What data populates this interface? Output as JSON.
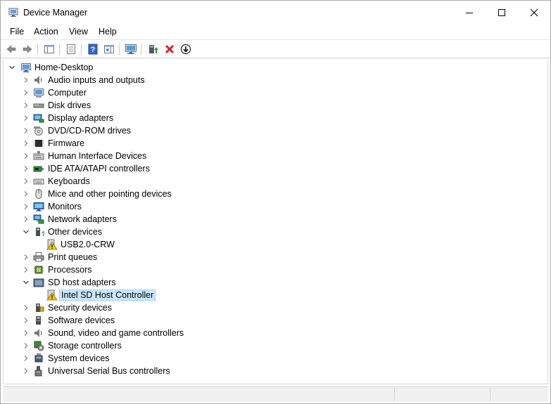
{
  "window": {
    "title": "Device Manager",
    "controls": {
      "minimize": "minimize",
      "maximize": "maximize",
      "close": "close"
    }
  },
  "menubar": {
    "items": [
      "File",
      "Action",
      "View",
      "Help"
    ]
  },
  "toolbar": {
    "buttons": [
      "back-arrow-icon",
      "forward-arrow-icon",
      "show-hide-console-tree-icon",
      "properties-icon",
      "help-icon",
      "action-pane-icon",
      "scan-hardware-icon",
      "update-driver-icon",
      "uninstall-device-icon",
      "disable-device-icon"
    ]
  },
  "tree": {
    "root": "Home-Desktop",
    "items": [
      {
        "label": "Audio inputs and outputs",
        "icon": "speaker-icon",
        "expanded": false
      },
      {
        "label": "Computer",
        "icon": "computer-icon",
        "expanded": false
      },
      {
        "label": "Disk drives",
        "icon": "disk-drive-icon",
        "expanded": false
      },
      {
        "label": "Display adapters",
        "icon": "display-adapter-icon",
        "expanded": false
      },
      {
        "label": "DVD/CD-ROM drives",
        "icon": "dvd-drive-icon",
        "expanded": false
      },
      {
        "label": "Firmware",
        "icon": "firmware-chip-icon",
        "expanded": false
      },
      {
        "label": "Human Interface Devices",
        "icon": "hid-keyboard-icon",
        "expanded": false
      },
      {
        "label": "IDE ATA/ATAPI controllers",
        "icon": "ide-controller-icon",
        "expanded": false
      },
      {
        "label": "Keyboards",
        "icon": "keyboard-icon",
        "expanded": false
      },
      {
        "label": "Mice and other pointing devices",
        "icon": "mouse-icon",
        "expanded": false
      },
      {
        "label": "Monitors",
        "icon": "monitor-icon",
        "expanded": false
      },
      {
        "label": "Network adapters",
        "icon": "network-adapter-icon",
        "expanded": false
      },
      {
        "label": "Other devices",
        "icon": "unknown-device-icon",
        "expanded": true,
        "children": [
          {
            "label": "USB2.0-CRW",
            "icon": "warning-device-icon"
          }
        ]
      },
      {
        "label": "Print queues",
        "icon": "printer-icon",
        "expanded": false
      },
      {
        "label": "Processors",
        "icon": "processor-icon",
        "expanded": false
      },
      {
        "label": "SD host adapters",
        "icon": "sd-adapter-icon",
        "expanded": true,
        "children": [
          {
            "label": "Intel SD Host Controller",
            "icon": "warning-device-icon",
            "selected": true
          }
        ]
      },
      {
        "label": "Security devices",
        "icon": "security-device-icon",
        "expanded": false
      },
      {
        "label": "Software devices",
        "icon": "software-device-icon",
        "expanded": false
      },
      {
        "label": "Sound, video and game controllers",
        "icon": "sound-controller-icon",
        "expanded": false
      },
      {
        "label": "Storage controllers",
        "icon": "storage-controller-icon",
        "expanded": false
      },
      {
        "label": "System devices",
        "icon": "system-device-icon",
        "expanded": false
      },
      {
        "label": "Universal Serial Bus controllers",
        "icon": "usb-icon",
        "expanded": false
      }
    ]
  },
  "colors": {
    "selection_bg": "#cce8ff",
    "selection_border": "#99d1ff",
    "warning_yellow": "#f5c400",
    "uninstall_red": "#e02020",
    "update_green": "#2e9b2e",
    "help_blue": "#3366cc"
  }
}
